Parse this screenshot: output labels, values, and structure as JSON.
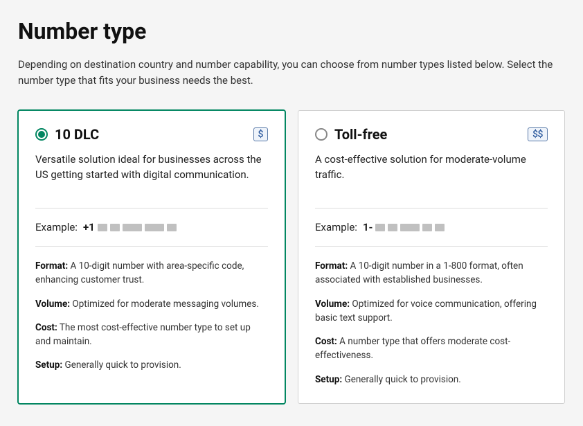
{
  "page": {
    "title": "Number type",
    "description": "Depending on destination country and number capability, you can choose from number types listed below. Select the number type that fits your business needs the best."
  },
  "example_label": "Example:",
  "labels": {
    "format": "Format:",
    "volume": "Volume:",
    "cost": "Cost:",
    "setup": "Setup:"
  },
  "cards": [
    {
      "id": "10dlc",
      "selected": true,
      "title": "10 DLC",
      "price_badge": "$",
      "description": "Versatile solution ideal for businesses across the US getting started with digital communication.",
      "example_prefix": "+1",
      "format": "A 10-digit number with area-specific code, enhancing customer trust.",
      "volume": "Optimized for moderate messaging volumes.",
      "cost": "The most cost-effective number type to set up and maintain.",
      "setup": "Generally quick to provision."
    },
    {
      "id": "tollfree",
      "selected": false,
      "title": "Toll-free",
      "price_badge": "$$",
      "description": "A cost-effective solution for moderate-volume traffic.",
      "example_prefix": "1-",
      "format": "A 10-digit number in a 1-800 format, often associated with established businesses.",
      "volume": "Optimized for voice communication, offering basic text support.",
      "cost": "A number type that offers moderate cost-effectiveness.",
      "setup": "Generally quick to provision."
    }
  ]
}
